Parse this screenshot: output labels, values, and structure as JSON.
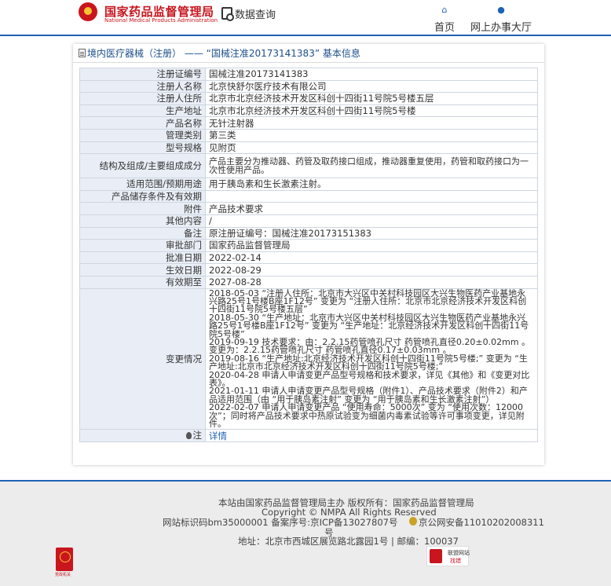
{
  "header": {
    "site_title": "国家药品监督管理局",
    "site_subtitle": "National Medical Products Administration",
    "query_label": "数据查询",
    "nav": [
      {
        "label": "首页",
        "icon": "home-icon"
      },
      {
        "label": "网上办事大厅",
        "icon": "user-icon"
      }
    ]
  },
  "panel": {
    "title": "境内医疗器械（注册） —— “国械注准20173141383” 基本信息",
    "rows": [
      {
        "key": "注册证编号",
        "value": "国械注准20173141383"
      },
      {
        "key": "注册人名称",
        "value": "北京快舒尔医疗技术有限公司"
      },
      {
        "key": "注册人住所",
        "value": "北京市北京经济技术开发区科创十四街11号院5号楼五层"
      },
      {
        "key": "生产地址",
        "value": "北京市北京经济技术开发区科创十四街11号院5号楼"
      },
      {
        "key": "产品名称",
        "value": "无针注射器"
      },
      {
        "key": "管理类别",
        "value": "第三类"
      },
      {
        "key": "型号规格",
        "value": "见附页"
      },
      {
        "key": "结构及组成/主要组成成分",
        "value": "产品主要分为推动器、药管及取药接口组成，推动器重复使用，药管和取药接口为一次性使用产品。"
      },
      {
        "key": "适用范围/预期用途",
        "value": "用于胰岛素和生长激素注射。"
      },
      {
        "key": "产品储存条件及有效期",
        "value": ""
      },
      {
        "key": "附件",
        "value": "产品技术要求"
      },
      {
        "key": "其他内容",
        "value": "/"
      },
      {
        "key": "备注",
        "value": "原注册证编号：国械注准20173151383"
      },
      {
        "key": "审批部门",
        "value": "国家药品监督管理局"
      },
      {
        "key": "批准日期",
        "value": "2022-02-14"
      },
      {
        "key": "生效日期",
        "value": "2022-08-29"
      },
      {
        "key": "有效期至",
        "value": "2027-08-28"
      }
    ],
    "changes_key": "变更情况",
    "changes": [
      "2018-05-03 “注册人住所：北京市大兴区中关村科技园区大兴生物医药产业基地永兴路25号1号楼B座1F12号” 变更为 “注册人住所：北京市北京经济技术开发区科创十四街11号院5号楼五层”",
      "2018-05-30 “生产地址：北京市大兴区中关村科技园区大兴生物医药产业基地永兴路25号1号楼B座1F12号” 变更为 “生产地址：北京经济技术开发区科创十四街11号院5号楼”",
      "2019-09-19 技术要求：由：2.2.15药管喷孔尺寸 药管喷孔直径0.20±0.02mm 。 变更为：2.2.15药管喷孔尺寸 药管喷孔直径0.17±0.03mm 。",
      "2019-08-16 “生产地址:北京经济技术开发区科创十四街11号院5号楼;” 变更为 “生产地址:北京市北京经济技术开发区科创十四街11号院5号楼;”",
      "2020-04-28 申请人申请变更产品型号规格和技术要求，详见《其他》和《变更对比表》。",
      "2021-01-11 申请人申请变更产品型号规格（附件1）、产品技术要求（附件2）和产品适用范围（由 “用于胰岛素注射” 变更为 “用于胰岛素和生长激素注射”）",
      "2022-02-07 申请人申请变更产品 “使用寿命：5000次” 变为 “使用次数：12000次”；同时将产品技术要求中热原试验变为细菌内毒素试验等许可事项变更，详见附件。"
    ],
    "note_key": "注",
    "note_link": "详情"
  },
  "footer": {
    "line1": "本站由国家药品监督管理局主办 版权所有：国家药品监督管理局",
    "line2": "Copyright © NMPA All Rights Reserved",
    "line3": "网站标识码bm35000001  备案序号:京ICP备13027807号",
    "police": "京公网安备11010202008311",
    "police_suffix": "号",
    "line4": "地址：北京市西城区展览路北露园1号 | 邮编：100037",
    "gov_badge_text": "党政机关",
    "report_line1": "联盟网站",
    "report_line2": "找错"
  },
  "colors": {
    "brand_red": "#c9151e",
    "brand_blue": "#1e62b3",
    "key_bg": "#e9eef6"
  }
}
